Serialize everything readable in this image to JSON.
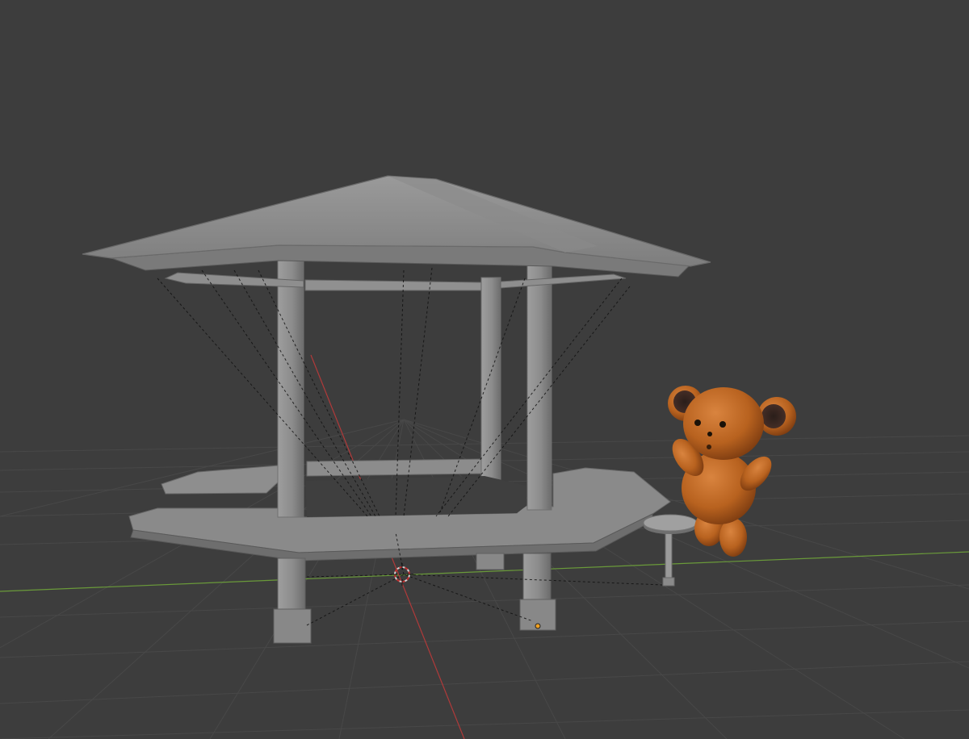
{
  "viewport": {
    "mode": "solid-shading-3d-viewport",
    "background_color": "#3d3d3d",
    "grid_color": "#4a4a4a",
    "x_axis_color": "#b03a3a",
    "y_axis_color": "#6a9a3a",
    "object_color": "#8c8c8c",
    "accent_color": "#c8782a"
  },
  "scene_objects": [
    {
      "name": "gazebo",
      "icon": "gazebo-mesh"
    },
    {
      "name": "stool",
      "icon": "stool-mesh"
    },
    {
      "name": "teddy-bear",
      "icon": "teddy-bear-mesh"
    }
  ],
  "gizmos": [
    {
      "name": "3d-cursor",
      "icon": "3d-cursor-icon"
    },
    {
      "name": "object-origin",
      "icon": "origin-dot-icon"
    }
  ]
}
